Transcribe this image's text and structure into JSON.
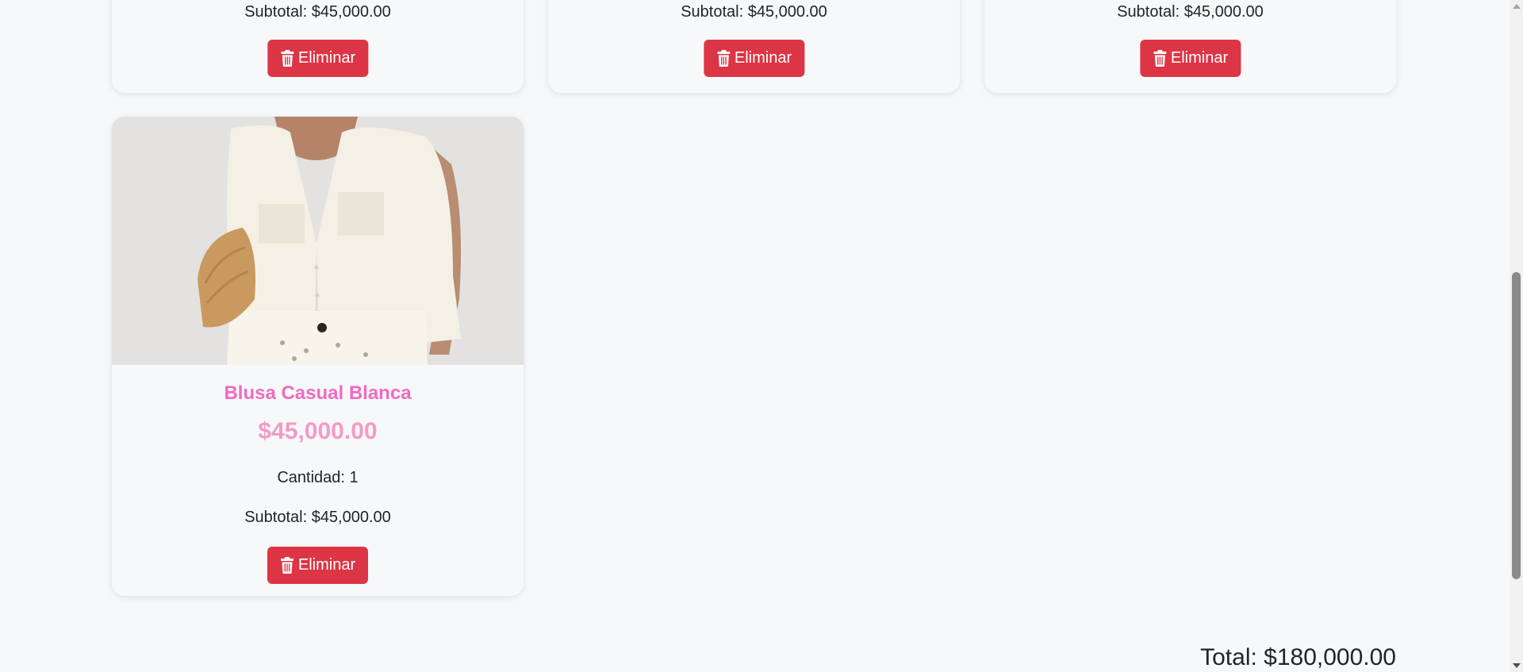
{
  "top_cards": [
    {
      "subtotal": "Subtotal: $45,000.00",
      "delete_label": "Eliminar"
    },
    {
      "subtotal": "Subtotal: $45,000.00",
      "delete_label": "Eliminar"
    },
    {
      "subtotal": "Subtotal: $45,000.00",
      "delete_label": "Eliminar"
    }
  ],
  "product": {
    "name": "Blusa Casual Blanca",
    "price": "$45,000.00",
    "quantity": "Cantidad: 1",
    "subtotal": "Subtotal: $45,000.00",
    "delete_label": "Eliminar",
    "image_icon": "product-photo"
  },
  "total": "Total: $180,000.00",
  "colors": {
    "delete_button": "#dc3545",
    "product_name": "#f06bc0",
    "product_price": "#f59ac6",
    "page_background": "#f7f8fa"
  },
  "icons": {
    "delete": "trash-icon"
  }
}
